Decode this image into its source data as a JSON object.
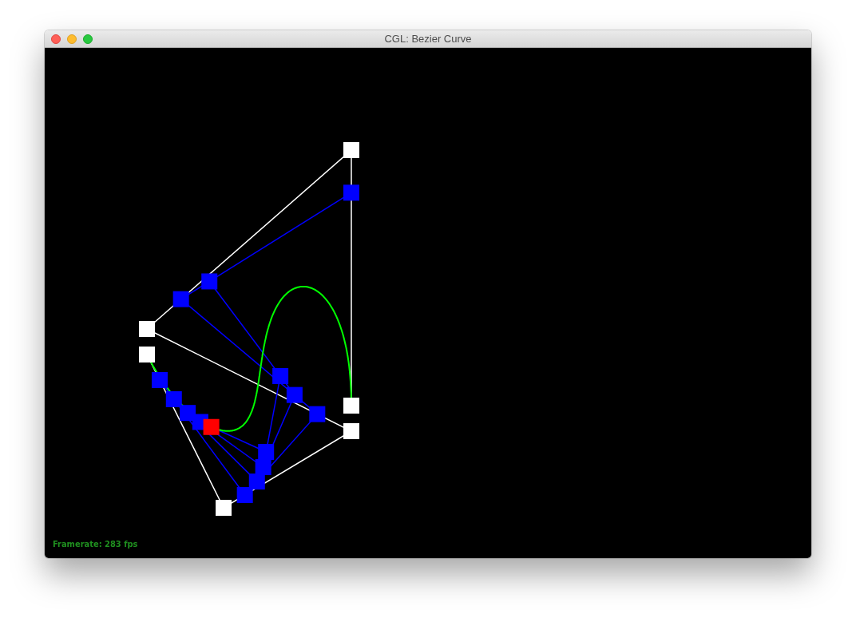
{
  "window": {
    "title": "CGL: Bezier Curve"
  },
  "viewport": {
    "framerate": "Framerate: 283 fps"
  }
}
